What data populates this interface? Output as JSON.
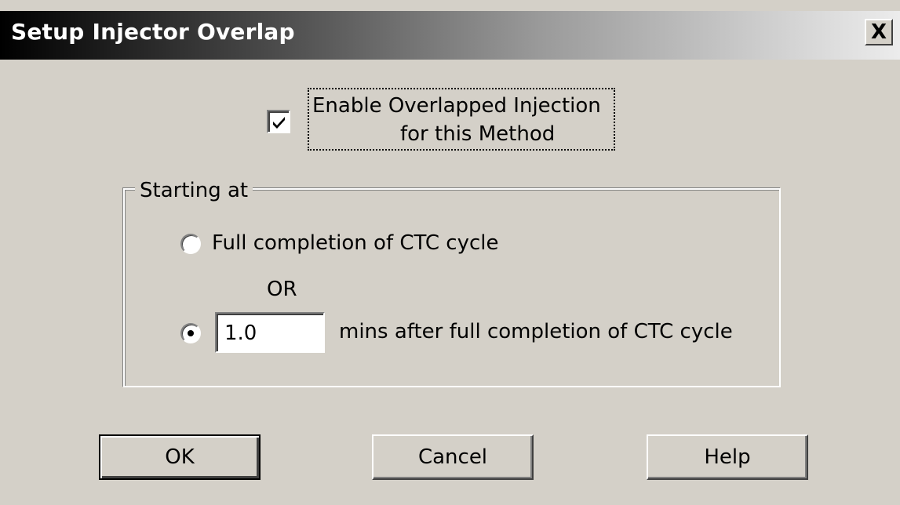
{
  "dialog": {
    "title": "Setup Injector Overlap",
    "close_label": "X"
  },
  "enable_option": {
    "label_line1": "Enable Overlapped Injection",
    "label_line2": "for this Method",
    "checked": true
  },
  "starting_group": {
    "label": "Starting at",
    "option_full_completion": "Full completion of CTC cycle",
    "or_label": "OR",
    "minutes_value": "1.0",
    "option_mins_after": "mins after full completion of CTC cycle",
    "selected": "mins_after"
  },
  "buttons": {
    "ok": "OK",
    "cancel": "Cancel",
    "help": "Help"
  }
}
